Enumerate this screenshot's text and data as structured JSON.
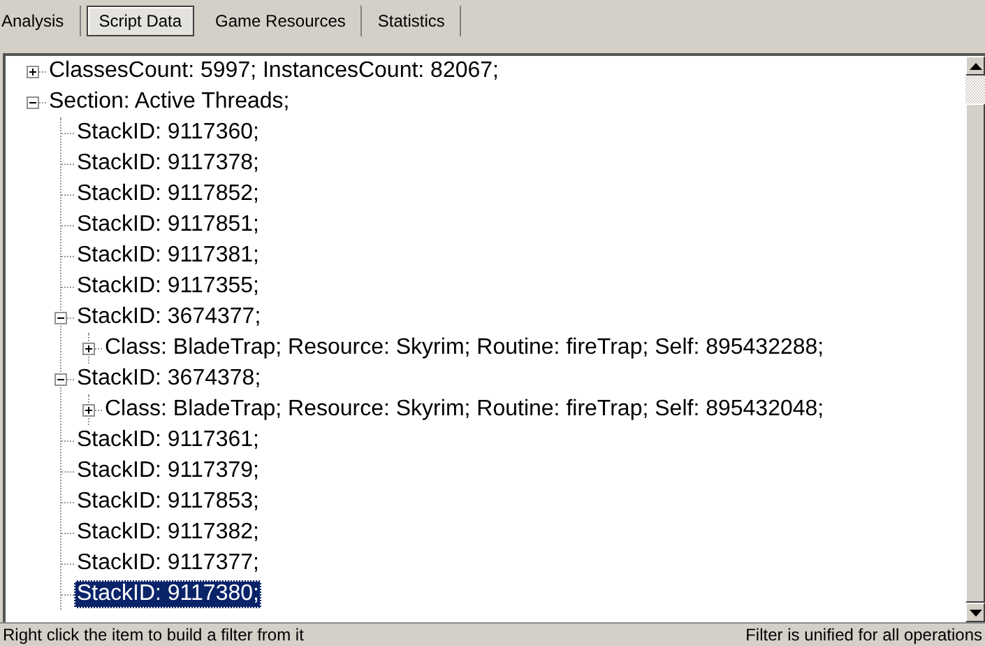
{
  "tabs": [
    {
      "label": "Analysis",
      "selected": false
    },
    {
      "label": "Script Data",
      "selected": true
    },
    {
      "label": "Game Resources",
      "selected": false
    },
    {
      "label": "Statistics",
      "selected": false
    }
  ],
  "tree": [
    {
      "label": "ClassesCount: 5997; InstancesCount: 82067;",
      "expanded": false,
      "selected": false
    },
    {
      "label": "Section: Active Threads;",
      "expanded": true,
      "selected": false,
      "children": [
        {
          "label": "StackID: 9117360;",
          "selected": false
        },
        {
          "label": "StackID: 9117378;",
          "selected": false
        },
        {
          "label": "StackID: 9117852;",
          "selected": false
        },
        {
          "label": "StackID: 9117851;",
          "selected": false
        },
        {
          "label": "StackID: 9117381;",
          "selected": false
        },
        {
          "label": "StackID: 9117355;",
          "selected": false
        },
        {
          "label": "StackID: 3674377;",
          "expanded": true,
          "selected": false,
          "children": [
            {
              "label": "Class: BladeTrap; Resource: Skyrim; Routine: fireTrap; Self: 895432288;",
              "expanded": false,
              "selected": false
            }
          ]
        },
        {
          "label": "StackID: 3674378;",
          "expanded": true,
          "selected": false,
          "children": [
            {
              "label": "Class: BladeTrap; Resource: Skyrim; Routine: fireTrap; Self: 895432048;",
              "expanded": false,
              "selected": false
            }
          ]
        },
        {
          "label": "StackID: 9117361;",
          "selected": false
        },
        {
          "label": "StackID: 9117379;",
          "selected": false
        },
        {
          "label": "StackID: 9117853;",
          "selected": false
        },
        {
          "label": "StackID: 9117382;",
          "selected": false
        },
        {
          "label": "StackID: 9117377;",
          "selected": false
        },
        {
          "label": "StackID: 9117380;",
          "selected": true
        }
      ]
    }
  ],
  "status_bar": {
    "left": "Right click the item to build a filter from it",
    "right": "Filter is unified for all operations"
  }
}
